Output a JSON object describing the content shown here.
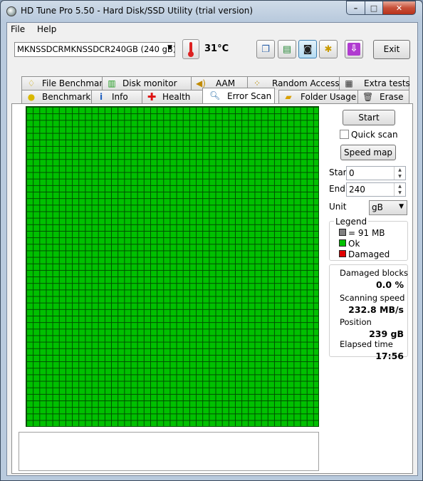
{
  "window": {
    "title": "HD Tune Pro 5.50 - Hard Disk/SSD Utility (trial version)",
    "controls": {
      "minimize": "–",
      "maximize": "□",
      "close": "✕"
    }
  },
  "menu": {
    "file": "File",
    "help": "Help"
  },
  "toolbar": {
    "drive": "MKNSSDCRMKNSSDCR240GB (240 gB)",
    "temperature": "31°C",
    "exit_label": "Exit"
  },
  "tabs": {
    "row_back": [
      {
        "id": "file-benchmark",
        "label": "File Benchmark"
      },
      {
        "id": "disk-monitor",
        "label": "Disk monitor"
      },
      {
        "id": "aam",
        "label": "AAM"
      },
      {
        "id": "random-access",
        "label": "Random Access"
      },
      {
        "id": "extra-tests",
        "label": "Extra tests"
      }
    ],
    "row_front": [
      {
        "id": "benchmark",
        "label": "Benchmark"
      },
      {
        "id": "info",
        "label": "Info"
      },
      {
        "id": "health",
        "label": "Health"
      },
      {
        "id": "error-scan",
        "label": "Error Scan",
        "selected": true
      },
      {
        "id": "folder-usage",
        "label": "Folder Usage"
      },
      {
        "id": "erase",
        "label": "Erase"
      }
    ]
  },
  "error_scan": {
    "start_button": "Start",
    "quick_scan_label": "Quick scan",
    "quick_scan_checked": false,
    "speed_map_button": "Speed map",
    "start_label": "Start",
    "start_value": "0",
    "end_label": "End",
    "end_value": "240",
    "unit_label": "Unit",
    "unit_value": "gB",
    "legend": {
      "title": "Legend",
      "block": "= 91 MB",
      "ok": "Ok",
      "damaged": "Damaged",
      "colors": {
        "block": "#808080",
        "ok": "#00c000",
        "damaged": "#e00000"
      }
    },
    "stats": {
      "damaged_blocks_label": "Damaged blocks",
      "damaged_blocks_value": "0.0 %",
      "scanning_speed_label": "Scanning speed",
      "scanning_speed_value": "232.8 MB/s",
      "position_label": "Position",
      "position_value": "239 gB",
      "elapsed_label": "Elapsed time",
      "elapsed_value": "17:56"
    },
    "grid_status": "all blocks ok"
  }
}
